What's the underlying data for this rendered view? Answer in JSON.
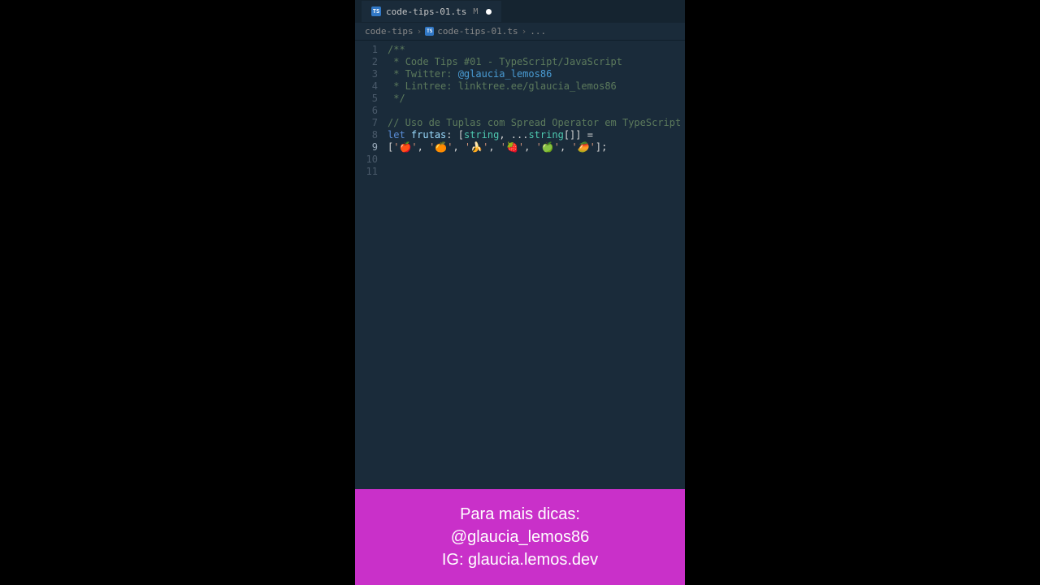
{
  "tab": {
    "filename": "code-tips-01.ts",
    "modified_indicator": "M"
  },
  "breadcrumb": {
    "folder": "code-tips",
    "file": "code-tips-01.ts",
    "more": "..."
  },
  "code": {
    "line1": "/**",
    "line2_prefix": " * ",
    "line2_text": "Code Tips #01 - TypeScript/JavaScript",
    "line3_prefix": " * Twitter: ",
    "line3_handle": "@glaucia_lemos86",
    "line4_prefix": " * Lintree: ",
    "line4_text": "linktree.ee/glaucia_lemos86",
    "line5": " */",
    "line7_comment": "// Uso de Tuplas com Spread Operator em TypeScript",
    "line8_let": "let",
    "line8_var": "frutas",
    "line8_colon": ": [",
    "line8_string1": "string",
    "line8_comma": ", ...",
    "line8_string2": "string",
    "line8_brackets": "[]] ",
    "line8_eq": "=",
    "line9_open": "[",
    "line9_s1": "'🍎'",
    "line9_s2": "'🍊'",
    "line9_s3": "'🍌'",
    "line9_s4": "'🍓'",
    "line9_s5": "'🍏'",
    "line9_s6": "'🥭'",
    "line9_close": "];",
    "line9_comma": ", "
  },
  "line_numbers": [
    "1",
    "2",
    "3",
    "4",
    "5",
    "6",
    "7",
    "8",
    "9",
    "10",
    "11"
  ],
  "footer": {
    "line1": "Para mais dicas:",
    "line2": "@glaucia_lemos86",
    "line3": "IG: glaucia.lemos.dev"
  }
}
